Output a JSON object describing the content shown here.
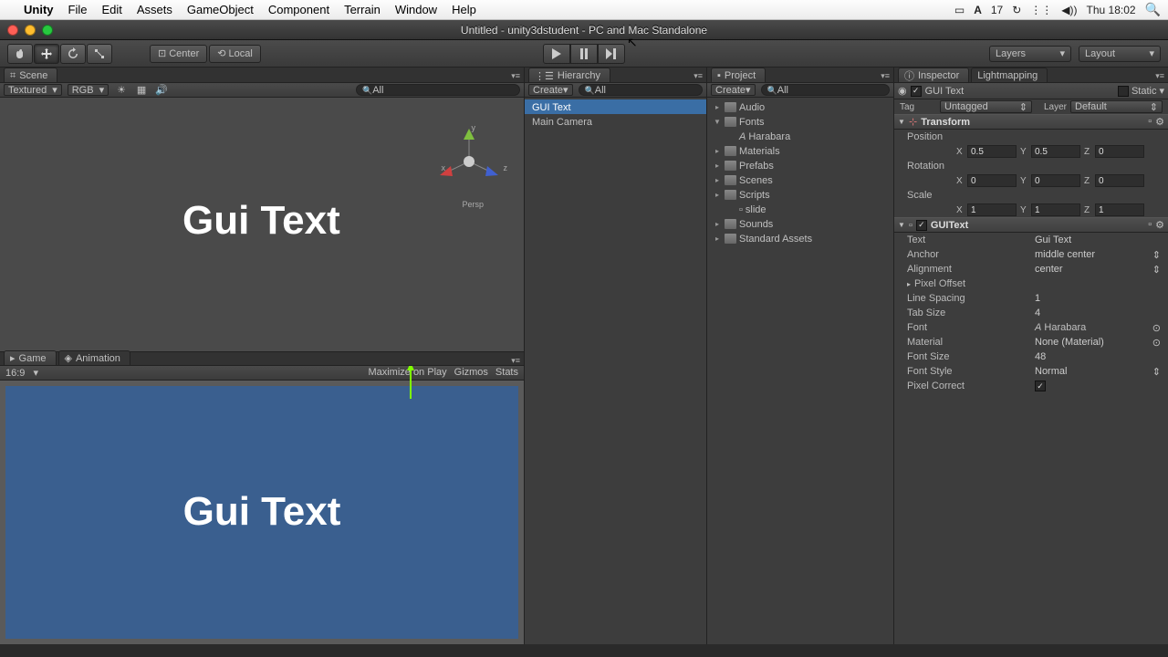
{
  "mac_menu": {
    "app": "Unity",
    "items": [
      "File",
      "Edit",
      "Assets",
      "GameObject",
      "Component",
      "Terrain",
      "Window",
      "Help"
    ],
    "battery_pct": "17",
    "clock": "Thu 18:02"
  },
  "window_title": "Untitled - unity3dstudent - PC and Mac Standalone",
  "toolbar": {
    "pivot_center": "Center",
    "pivot_local": "Local",
    "layers_label": "Layers",
    "layout_label": "Layout"
  },
  "scene": {
    "tab": "Scene",
    "shading": "Textured",
    "render_mode": "RGB",
    "search_placeholder": "All",
    "persp": "Persp",
    "axes": {
      "x": "x",
      "y": "y",
      "z": "z"
    },
    "gui_text_display": "Gui Text"
  },
  "game": {
    "tab_game": "Game",
    "tab_animation": "Animation",
    "aspect": "16:9",
    "maximize": "Maximize on Play",
    "gizmos": "Gizmos",
    "stats": "Stats",
    "text": "Gui Text"
  },
  "hierarchy": {
    "tab": "Hierarchy",
    "create": "Create",
    "search_placeholder": "All",
    "items": [
      "GUI Text",
      "Main Camera"
    ]
  },
  "project": {
    "tab": "Project",
    "create": "Create",
    "search_placeholder": "All",
    "folders": [
      {
        "name": "Audio",
        "depth": 0,
        "expandable": true
      },
      {
        "name": "Fonts",
        "depth": 0,
        "expandable": true,
        "expanded": true
      },
      {
        "name": "Harabara",
        "depth": 1,
        "asset": true
      },
      {
        "name": "Materials",
        "depth": 0,
        "expandable": true
      },
      {
        "name": "Prefabs",
        "depth": 0,
        "expandable": true
      },
      {
        "name": "Scenes",
        "depth": 0,
        "expandable": true
      },
      {
        "name": "Scripts",
        "depth": 0,
        "expandable": true
      },
      {
        "name": "slide",
        "depth": 1,
        "asset": true,
        "script": true
      },
      {
        "name": "Sounds",
        "depth": 0,
        "expandable": true
      },
      {
        "name": "Standard Assets",
        "depth": 0,
        "expandable": true
      }
    ]
  },
  "inspector": {
    "tab_inspector": "Inspector",
    "tab_lightmapping": "Lightmapping",
    "object_name": "GUI Text",
    "static_label": "Static",
    "tag_label": "Tag",
    "tag_value": "Untagged",
    "layer_label": "Layer",
    "layer_value": "Default",
    "transform": {
      "title": "Transform",
      "position": {
        "label": "Position",
        "x": "0.5",
        "y": "0.5",
        "z": "0"
      },
      "rotation": {
        "label": "Rotation",
        "x": "0",
        "y": "0",
        "z": "0"
      },
      "scale": {
        "label": "Scale",
        "x": "1",
        "y": "1",
        "z": "1"
      }
    },
    "guitext": {
      "title": "GUIText",
      "text_label": "Text",
      "text_value": "Gui Text",
      "anchor_label": "Anchor",
      "anchor_value": "middle center",
      "alignment_label": "Alignment",
      "alignment_value": "center",
      "pixel_offset_label": "Pixel Offset",
      "line_spacing_label": "Line Spacing",
      "line_spacing_value": "1",
      "tab_size_label": "Tab Size",
      "tab_size_value": "4",
      "font_label": "Font",
      "font_value": "Harabara",
      "material_label": "Material",
      "material_value": "None (Material)",
      "font_size_label": "Font Size",
      "font_size_value": "48",
      "font_style_label": "Font Style",
      "font_style_value": "Normal",
      "pixel_correct_label": "Pixel Correct",
      "pixel_correct_checked": true
    }
  }
}
